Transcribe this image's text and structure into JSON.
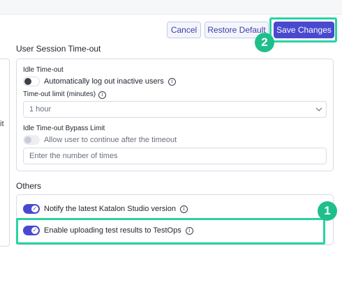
{
  "toolbar": {
    "cancel_label": "Cancel",
    "restore_label": "Restore Default",
    "save_label": "Save Changes"
  },
  "badges": {
    "badge_1": "1",
    "badge_2": "2"
  },
  "left_panel": {
    "text": "it"
  },
  "session": {
    "title": "User Session Time-out",
    "idle_label": "Idle Time-out",
    "auto_logout_label": "Automatically log out inactive users",
    "auto_logout_on": false,
    "limit_label": "Time-out limit (minutes)",
    "limit_value": "1 hour",
    "bypass_label": "Idle Time-out Bypass Limit",
    "allow_continue_label": "Allow user to continue after the timeout",
    "allow_continue_on": false,
    "times_placeholder": "Enter the number of times"
  },
  "others": {
    "title": "Others",
    "notify_label": "Notify the latest Katalon Studio version",
    "notify_on": true,
    "upload_label": "Enable uploading test results to TestOps",
    "upload_on": true
  },
  "colors": {
    "accent": "#4949cf",
    "highlight": "#29d3a2",
    "badge": "#1fbf8b"
  },
  "icons": {
    "info": "info-icon",
    "chevron": "chevron-down-icon",
    "check": "check-icon"
  }
}
